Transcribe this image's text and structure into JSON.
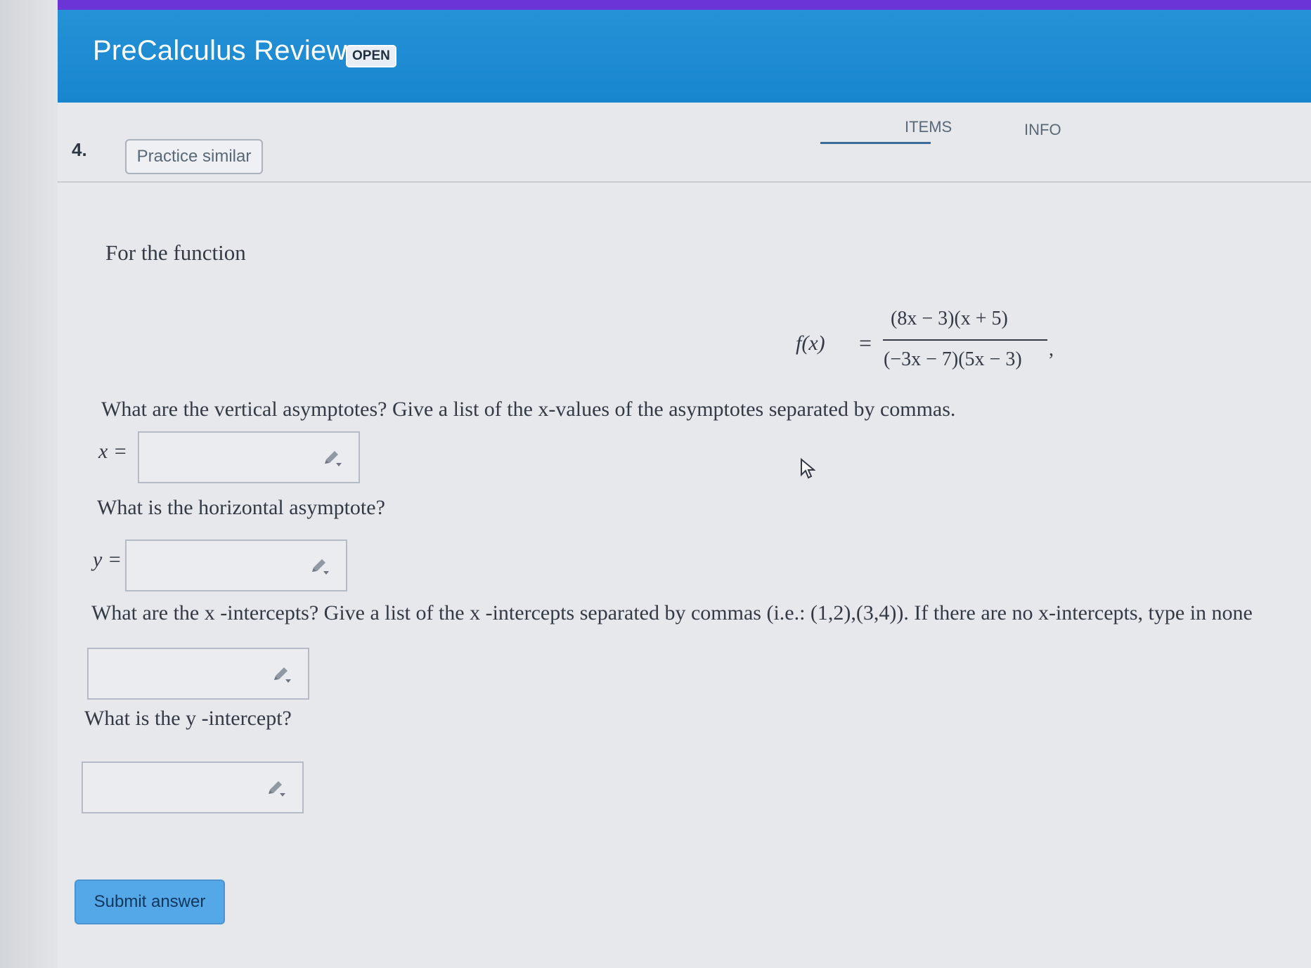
{
  "header": {
    "title": "PreCalculus Review",
    "badge": "OPEN"
  },
  "tabs": [
    {
      "label": "ITEMS",
      "active": true
    },
    {
      "label": "INFO",
      "active": false
    }
  ],
  "question": {
    "number": "4.",
    "practice_label": "Practice similar",
    "intro": "For the function",
    "formula": {
      "lhs": "f(x)",
      "eq": "=",
      "numerator": "(8x − 3)(x + 5)",
      "denominator": "(−3x − 7)(5x − 3)",
      "trailing": ","
    },
    "parts": [
      {
        "prompt": "What are the vertical asymptotes? Give a list of the x-values of the asymptotes separated by commas.",
        "var": "x =",
        "value": ""
      },
      {
        "prompt": "What is the horizontal asymptote?",
        "var": "y =",
        "value": ""
      },
      {
        "prompt": "What are the x -intercepts? Give a list of the x -intercepts separated by commas (i.e.: (1,2),(3,4)). If there are no x-intercepts, type in none",
        "var": "",
        "value": ""
      },
      {
        "prompt": "What is the y -intercept?",
        "var": "",
        "value": ""
      }
    ],
    "submit_label": "Submit answer"
  },
  "icons": {
    "answer_tool": "pencil-dropdown-icon",
    "pointer": "mouse-cursor-icon"
  },
  "colors": {
    "header_bg": "#1886cf",
    "top_bar": "#6a34d6",
    "submit_bg": "#55a8e8"
  }
}
